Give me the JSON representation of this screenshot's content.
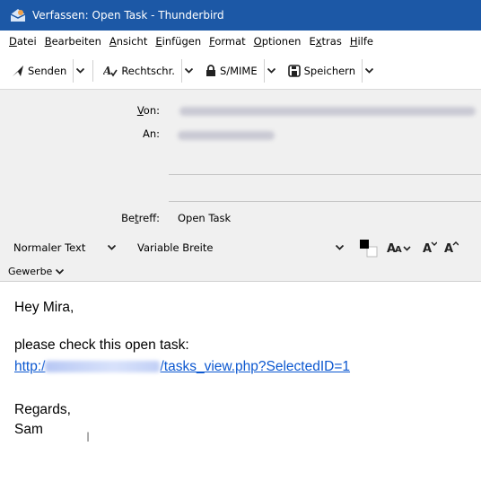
{
  "window": {
    "title": "Verfassen: Open Task - Thunderbird",
    "titlebar_color": "#1c58a6"
  },
  "menu": [
    {
      "key": "D",
      "rest": "atei"
    },
    {
      "key": "B",
      "rest": "earbeiten"
    },
    {
      "key": "A",
      "rest": "nsicht"
    },
    {
      "key": "E",
      "rest": "infügen"
    },
    {
      "key": "F",
      "rest": "ormat"
    },
    {
      "key": "O",
      "rest": "ptionen"
    },
    {
      "pre": "E",
      "key": "x",
      "rest": "tras"
    },
    {
      "key": "H",
      "rest": "ilfe"
    }
  ],
  "toolbar": {
    "send_label": "Senden",
    "spell_label": "Rechtschr.",
    "smime_label": "S/MIME",
    "save_label": "Speichern"
  },
  "header": {
    "from_label_key": "V",
    "from_label_rest": "on:",
    "to_label": "An:",
    "subject_label_pre": "Be",
    "subject_label_key": "t",
    "subject_label_rest": "reff:",
    "subject_value": "Open Task"
  },
  "format": {
    "paragraph_style": "Normaler Text",
    "font": "Variable Breite",
    "gewerbe_label": "Gewerbe"
  },
  "message": {
    "greeting": "Hey Mira,",
    "intro": "please check this open task:",
    "link_prefix": "http:/",
    "link_suffix": "/tasks_view.php?SelectedID=1",
    "closing": "Regards,",
    "signature": "Sam",
    "link_color": "#0b57d0"
  }
}
